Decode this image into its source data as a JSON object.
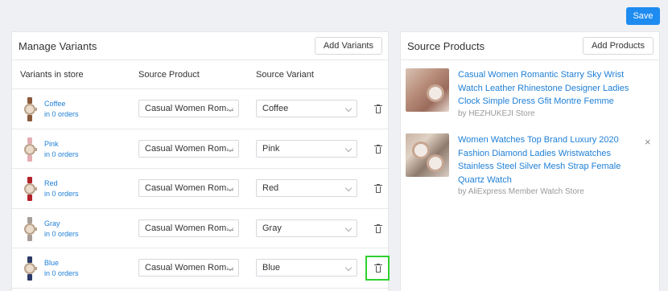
{
  "toolbar": {
    "save_label": "Save"
  },
  "variants_panel": {
    "title": "Manage Variants",
    "add_button": "Add Variants",
    "columns": [
      "Variants in store",
      "Source Product",
      "Source Variant"
    ],
    "rows": [
      {
        "name": "Coffee",
        "orders": "in 0 orders",
        "source_product": "Casual Women Rom...",
        "source_variant": "Coffee",
        "strap_color": "#8a5a3c"
      },
      {
        "name": "Pink",
        "orders": "in 0 orders",
        "source_product": "Casual Women Rom...",
        "source_variant": "Pink",
        "strap_color": "#e3aeb2"
      },
      {
        "name": "Red",
        "orders": "in 0 orders",
        "source_product": "Casual Women Rom...",
        "source_variant": "Red",
        "strap_color": "#b3232a"
      },
      {
        "name": "Gray",
        "orders": "in 0 orders",
        "source_product": "Casual Women Rom...",
        "source_variant": "Gray",
        "strap_color": "#a89e98"
      },
      {
        "name": "Blue",
        "orders": "in 0 orders",
        "source_product": "Casual Women Rom...",
        "source_variant": "Blue",
        "strap_color": "#2b3a67"
      }
    ]
  },
  "source_panel": {
    "title": "Source Products",
    "add_button": "Add Products",
    "products": [
      {
        "title": "Casual Women Romantic Starry Sky Wrist Watch Leather Rhinestone Designer Ladies Clock Simple Dress Gfit Montre Femme",
        "store": "by HEZHUKEJI Store"
      },
      {
        "title": "Women Watches Top Brand Luxury 2020 Fashion Diamond Ladies Wristwatches Stainless Steel Silver Mesh Strap Female Quartz Watch",
        "store": "by AliExpress Member Watch Store",
        "close": "×"
      }
    ]
  }
}
